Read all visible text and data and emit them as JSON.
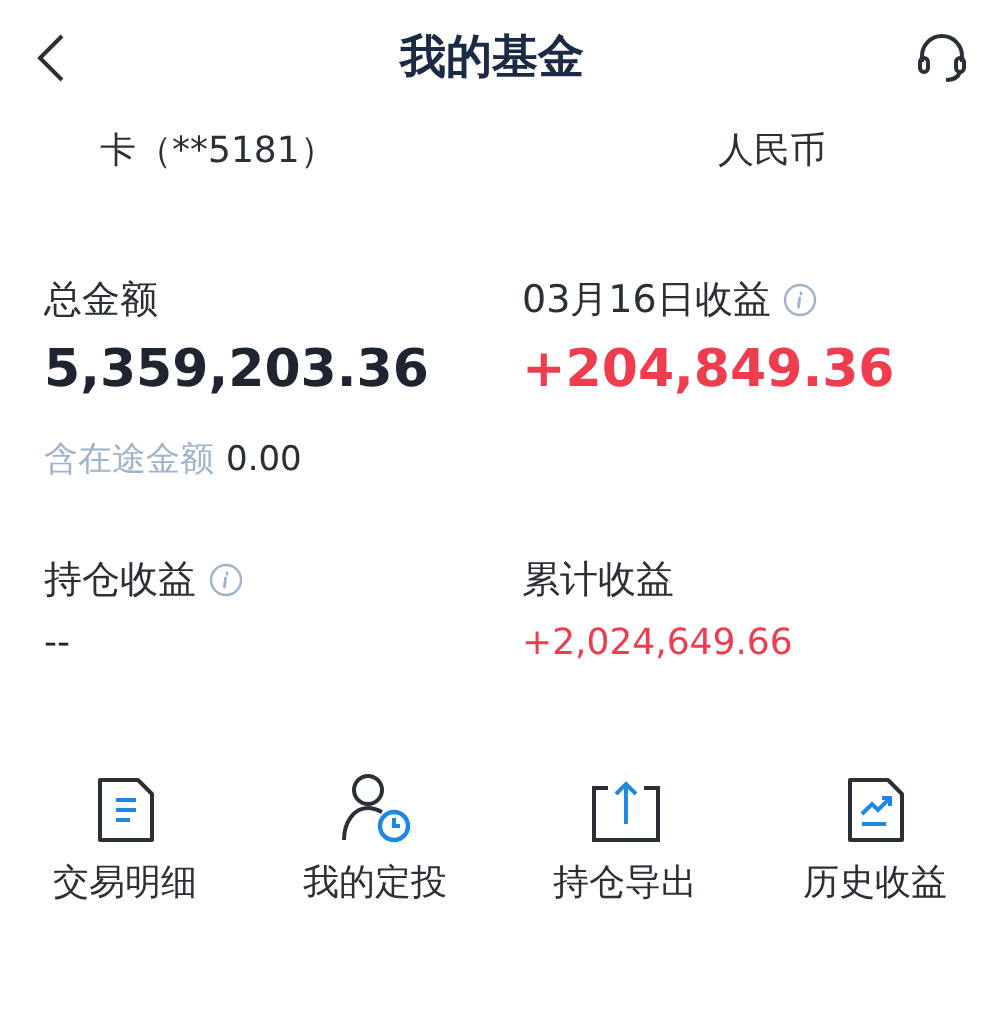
{
  "header": {
    "title": "我的基金"
  },
  "account": {
    "card": "卡（**5181）",
    "currency": "人民币"
  },
  "summary": [
    {
      "label": "总金额",
      "value": "5,359,203.36",
      "info": false,
      "color": "#1e2530"
    },
    {
      "label": "03月16日收益",
      "value": "+204,849.36",
      "info": true,
      "color": "#f03c4f"
    }
  ],
  "in_transit": {
    "label": "含在途金额",
    "value": "0.00"
  },
  "stats": [
    {
      "label": "持仓收益",
      "value": "--",
      "info": true,
      "color": "#1e2530"
    },
    {
      "label": "累计收益",
      "value": "+2,024,649.66",
      "info": false,
      "color": "#f03c4f"
    }
  ],
  "actions": [
    {
      "kind": "document",
      "label": "交易明细"
    },
    {
      "kind": "person",
      "label": "我的定投"
    },
    {
      "kind": "export",
      "label": "持仓导出"
    },
    {
      "kind": "chart",
      "label": "历史收益"
    }
  ]
}
